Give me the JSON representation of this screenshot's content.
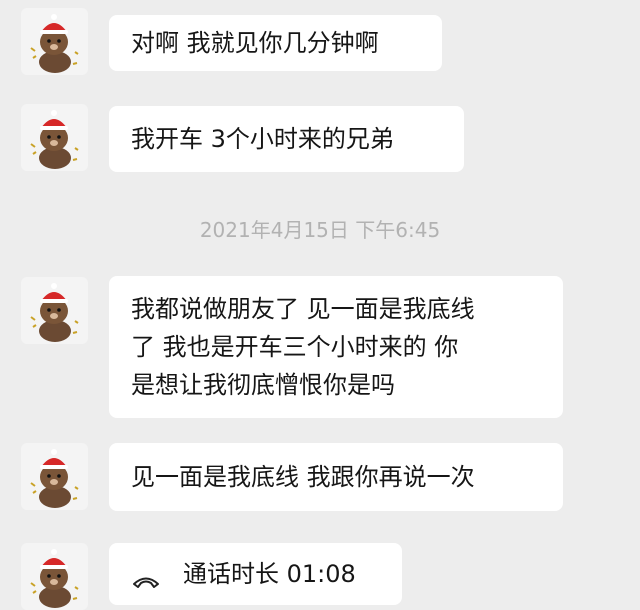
{
  "messages": [
    {
      "text": "对啊 我就见你几分钟啊",
      "avatar": "bear-icon"
    },
    {
      "text": "我开车 3个小时来的兄弟",
      "avatar": "bear-icon"
    },
    {
      "lines": [
        "我都说做朋友了 见一面是我底线",
        "了 我也是开车三个小时来的 你",
        "是想让我彻底憎恨你是吗"
      ],
      "avatar": "bear-icon"
    },
    {
      "text": "见一面是我底线 我跟你再说一次",
      "avatar": "bear-icon"
    }
  ],
  "timestamp": "2021年4月15日 下午6:45",
  "call": {
    "icon": "phone-hangup-icon",
    "label": "通话时长 01:08"
  },
  "colors": {
    "background": "#ededed",
    "bubble": "#ffffff",
    "text": "#161616",
    "timestamp": "#b2b2b2"
  }
}
